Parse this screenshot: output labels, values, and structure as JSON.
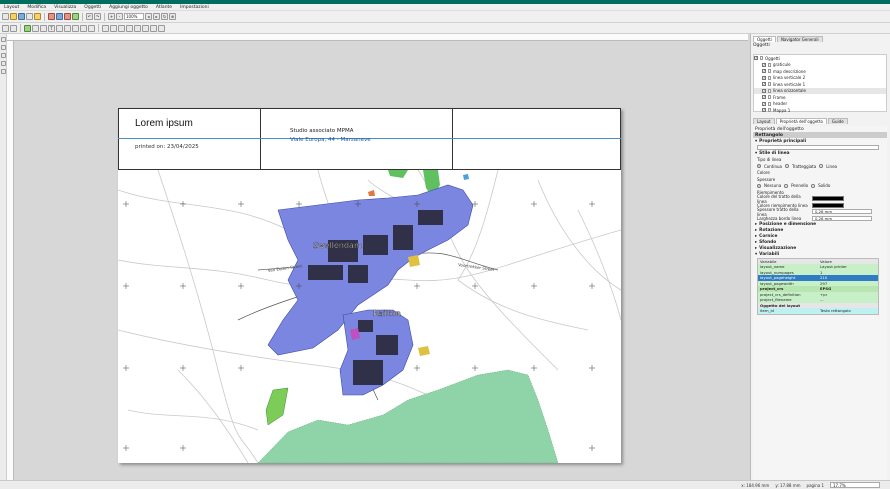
{
  "menu": [
    "Layout",
    "Modifica",
    "Visualizza",
    "Oggetti",
    "Aggiungi oggetto",
    "Atlante",
    "Impostazioni"
  ],
  "toolbar": {
    "zoom_value": "100%"
  },
  "paper": {
    "title": "Lorem ipsum",
    "printed_on": "printed on: 23/04/2025",
    "studio": "Studio associato MPMA",
    "address": "Viale Europa, 44 - Marsaneve"
  },
  "map": {
    "town1": "Swellendam",
    "town2": "Railton",
    "street1": "Van Eeden Street",
    "street2": "Voortrekker Street",
    "colors": {
      "urban": "#7b86e0",
      "forest": "#8fd4a8",
      "water": "#4ea0d8",
      "buildings": "#303048",
      "field": "#e0c040",
      "green": "#60c060"
    }
  },
  "right_panel": {
    "tabs": [
      "Layout",
      "Oggetto",
      "Guide"
    ],
    "top_tabs": [
      "Oggetti",
      "Navigator Generali"
    ],
    "items_title": "Oggetti",
    "items": [
      {
        "label": "Oggetti",
        "checked": true
      },
      {
        "label": "graticule",
        "checked": true
      },
      {
        "label": "map descrizione",
        "checked": true
      },
      {
        "label": "linea verticale 2",
        "checked": true
      },
      {
        "label": "linea verticale 1",
        "checked": true
      },
      {
        "label": "linea orizzontale",
        "checked": true
      },
      {
        "label": "Frame",
        "checked": true
      },
      {
        "label": "header",
        "checked": true
      },
      {
        "label": "Mappa 1",
        "checked": true
      }
    ],
    "props_tabs": [
      "Layout",
      "Proprietà dell'oggetto",
      "Guide"
    ],
    "props_title": "Proprietà dell'oggetto",
    "props_sub": "Rettangolo",
    "groups": {
      "main": "Proprietà principali",
      "style": "Stile di linea",
      "position": "Posizione e dimensione",
      "rotation": "Rotazione",
      "frame": "Cornice",
      "bg": "Sfondo",
      "render": "Visualizzazione",
      "vars": "Variabili"
    },
    "style_rows": {
      "type_label": "Tipo di linea",
      "type_opts": [
        "Continua",
        "Tratteggiata",
        "Linea"
      ],
      "color_label": "Colore",
      "width_label": "Spessore",
      "opts2": [
        "Nessuna",
        "Pennello",
        "Solido"
      ],
      "fill_label": "Riempimento",
      "stroke_color": "Colore del tratto della linea",
      "fill_color": "Colore riempimento linea",
      "stroke_width": "Spessore tratto della linea",
      "stroke_width_val": "0,26 mm",
      "join_style": "Larghezza bordo linea",
      "join_val": "0,26 mm"
    },
    "vars_header": [
      "Variabile",
      "Valore"
    ],
    "vars": [
      [
        "layout_name",
        "Layout printer"
      ],
      [
        "layout_numpages",
        "1"
      ],
      [
        "layout_pageheight",
        "210"
      ],
      [
        "layout_pagewidth",
        "297"
      ],
      [
        "project_crs",
        "EPSG"
      ],
      [
        "project_crs_definition",
        "+pr"
      ],
      [
        "project_filename",
        "..."
      ]
    ],
    "vars_group2": "Oggetto del layout",
    "vars_last": [
      "item_id",
      "Testo rettangolo"
    ]
  },
  "status": {
    "x": "x: 184.96 mm",
    "y": "y: 17.88 mm",
    "page": "pagina 1",
    "zoom": "17.7%"
  }
}
